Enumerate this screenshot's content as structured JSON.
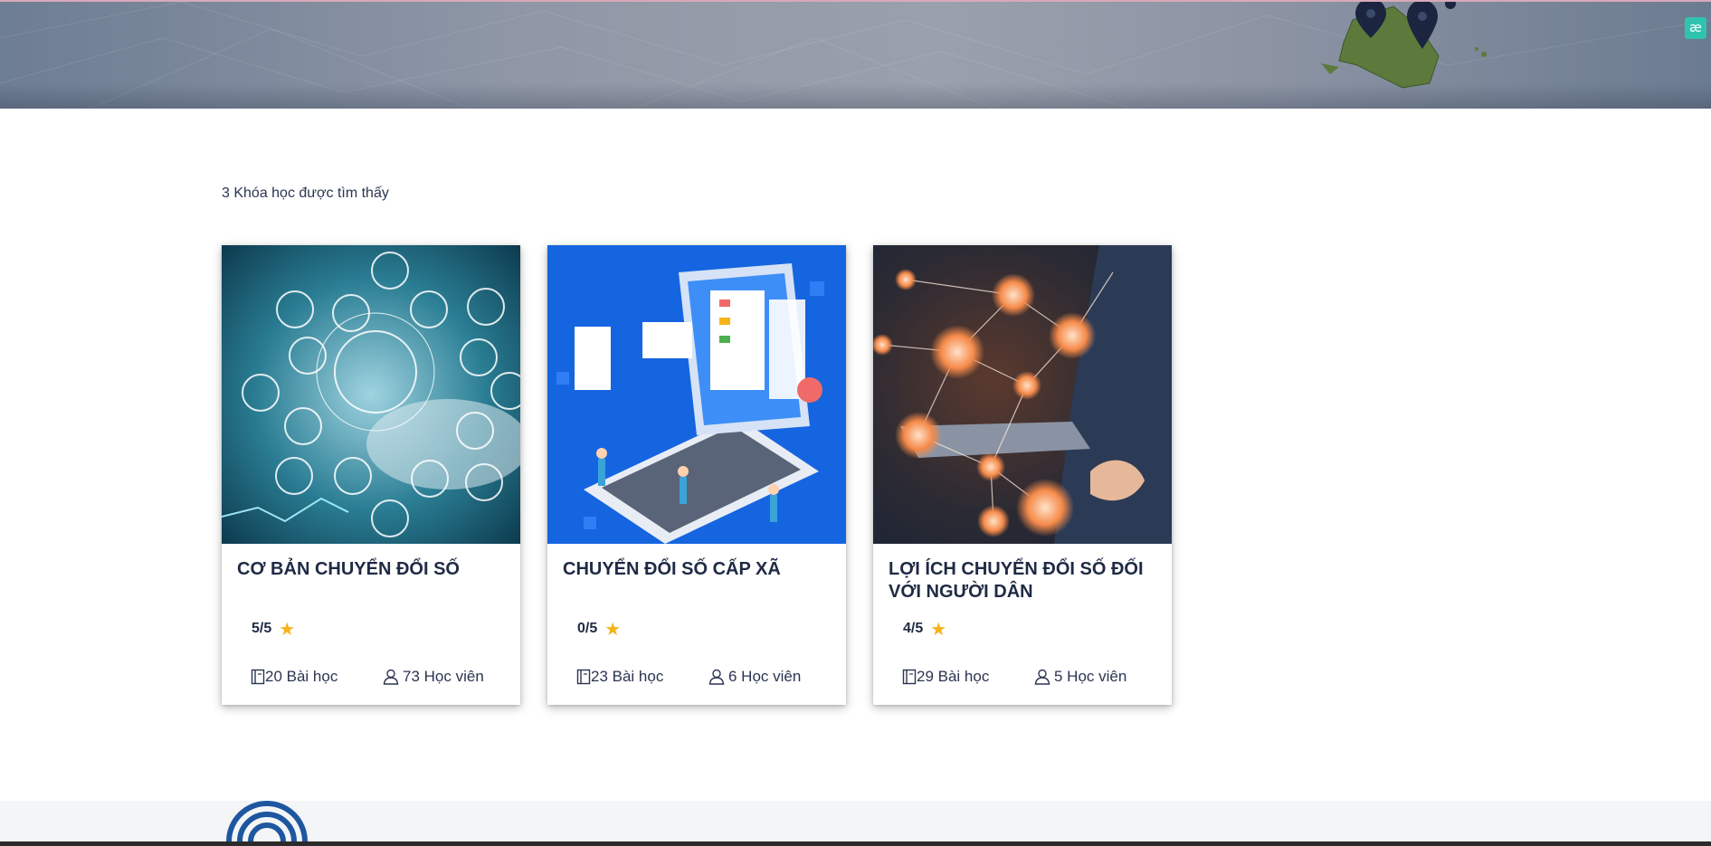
{
  "widget": {
    "label": "æ"
  },
  "results": {
    "count_text": "3 Khóa học được tìm thấy"
  },
  "courses": [
    {
      "title": "CƠ BẢN CHUYỂN ĐỔI SỐ",
      "rating": "5/5",
      "lessons": "20 Bài học",
      "students": "73 Học viên"
    },
    {
      "title": "CHUYỂN ĐỔI SỐ CẤP XÃ",
      "rating": "0/5",
      "lessons": "23 Bài học",
      "students": "6 Học viên"
    },
    {
      "title": "LỢI ÍCH CHUYỂN ĐỔI SỐ ĐỐI VỚI NGƯỜI DÂN",
      "rating": "4/5",
      "lessons": "29 Bài học",
      "students": "5 Học viên"
    }
  ],
  "colors": {
    "star": "#f4b41a",
    "hero": "#8f97a6",
    "card_text": "#1f2a44",
    "widget": "#2fc3b0"
  },
  "icons": [
    "star-icon",
    "book-icon",
    "user-icon",
    "map-pin-icon",
    "logo-icon"
  ]
}
